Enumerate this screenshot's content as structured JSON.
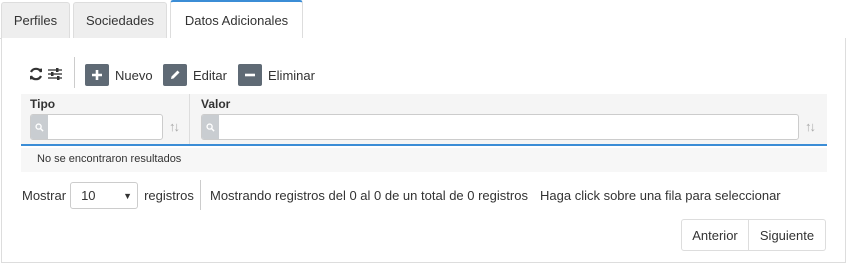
{
  "tabs": [
    {
      "label": "Perfiles"
    },
    {
      "label": "Sociedades"
    },
    {
      "label": "Datos Adicionales",
      "active": true
    }
  ],
  "toolbar": {
    "refresh_icon": "refresh-icon",
    "settings_icon": "sliders-icon",
    "nuevo_label": "Nuevo",
    "editar_label": "Editar",
    "eliminar_label": "Eliminar"
  },
  "table": {
    "columns": [
      {
        "header": "Tipo",
        "filter_value": ""
      },
      {
        "header": "Valor",
        "filter_value": ""
      }
    ],
    "empty_message": "No se encontraron resultados"
  },
  "footer": {
    "show_label": "Mostrar",
    "page_size": "10",
    "records_label": "registros",
    "summary": "Mostrando registros del 0 al 0 de un total de 0 registros",
    "hint": "Haga click sobre una fila para seleccionar",
    "prev_label": "Anterior",
    "next_label": "Siguiente"
  },
  "colors": {
    "accent": "#3b8dd6",
    "button_dark": "#5f6a75"
  }
}
